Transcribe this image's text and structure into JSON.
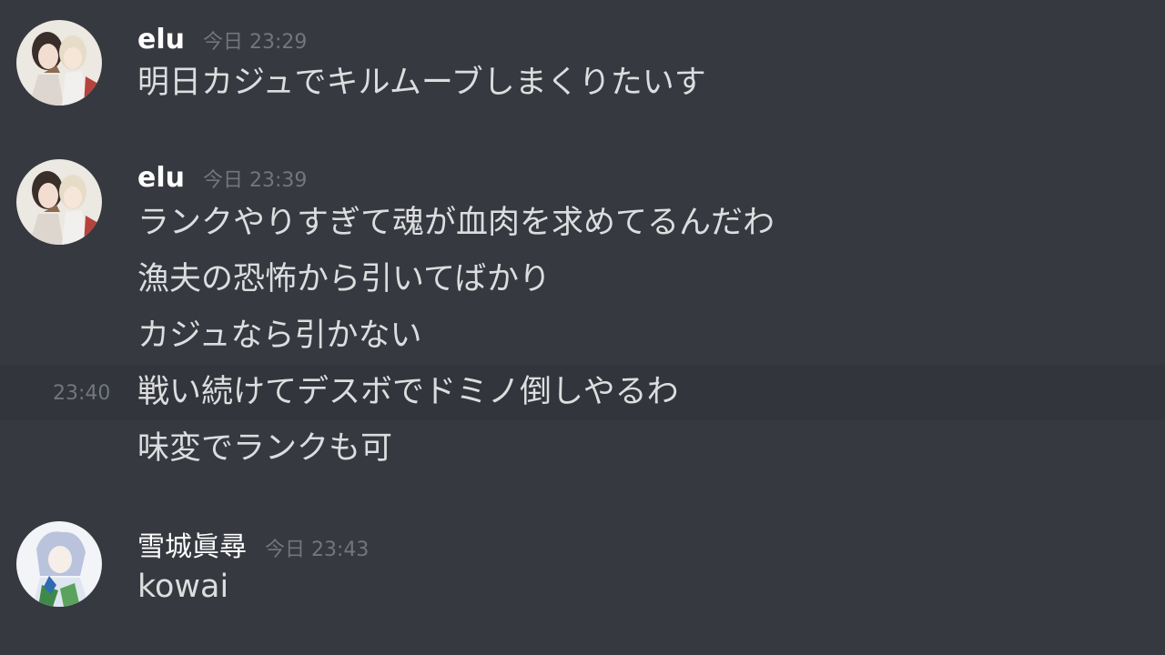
{
  "colors": {
    "background": "#36393f",
    "hover_row": "#32353b",
    "username": "#ffffff",
    "message_text": "#dcddde",
    "timestamp": "#72767d"
  },
  "messages": [
    {
      "author": "elu",
      "timestamp": "今日 23:29",
      "avatar_icon": "anime-characters-avatar",
      "lines": [
        {
          "text": "明日カジュでキルムーブしまくりたいす"
        }
      ]
    },
    {
      "author": "elu",
      "timestamp": "今日 23:39",
      "avatar_icon": "anime-characters-avatar",
      "lines": [
        {
          "text": "ランクやりすぎて魂が血肉を求めてるんだわ"
        },
        {
          "text": "漁夫の恐怖から引いてばかり"
        },
        {
          "text": "カジュなら引かない"
        },
        {
          "text": "戦い続けてデスボでドミノ倒しやるわ",
          "hover_time": "23:40"
        },
        {
          "text": "味変でランクも可"
        }
      ]
    },
    {
      "author": "雪城眞尋",
      "timestamp": "今日 23:43",
      "avatar_icon": "anime-girl-avatar",
      "lines": [
        {
          "text": "kowai"
        }
      ]
    }
  ]
}
